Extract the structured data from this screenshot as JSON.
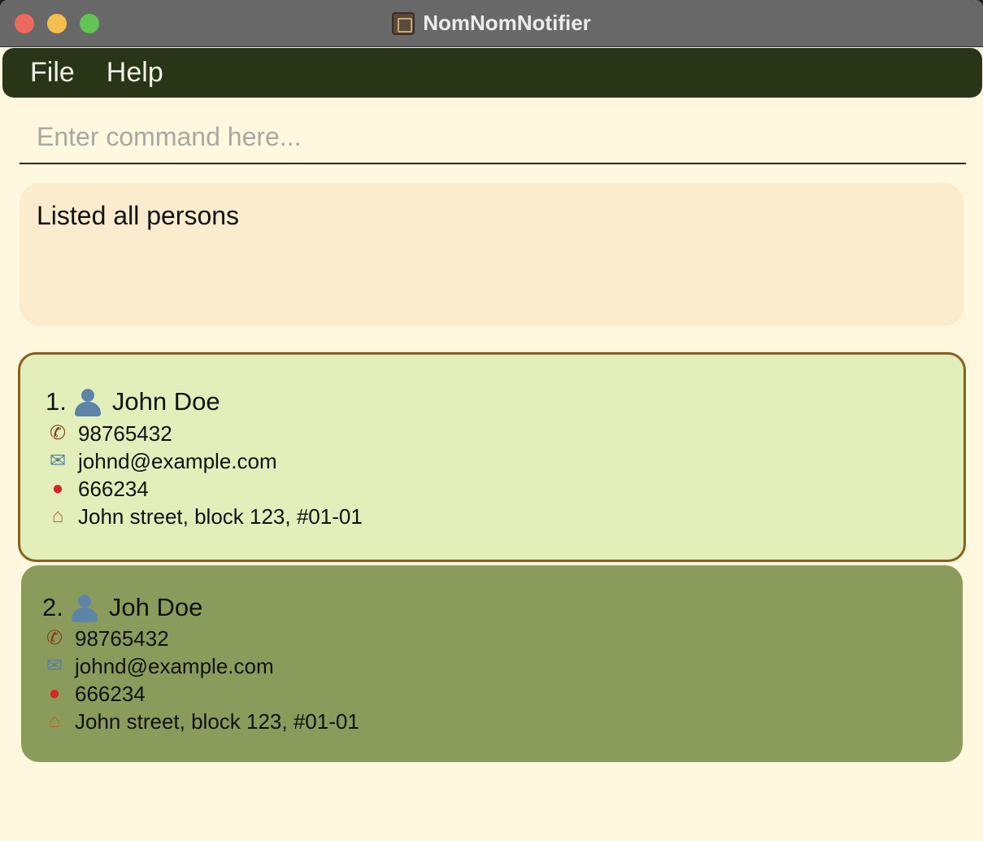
{
  "window": {
    "title": "NomNomNotifier"
  },
  "menu": {
    "items": [
      "File",
      "Help"
    ]
  },
  "command": {
    "placeholder": "Enter command here..."
  },
  "result": {
    "message": "Listed all persons"
  },
  "persons": [
    {
      "index": "1.",
      "name": "John Doe",
      "phone": "98765432",
      "email": "johnd@example.com",
      "postal": "666234",
      "address": "John street, block 123, #01-01",
      "selected": true
    },
    {
      "index": "2.",
      "name": "Joh Doe",
      "phone": "98765432",
      "email": "johnd@example.com",
      "postal": "666234",
      "address": "John street, block 123, #01-01",
      "selected": false
    }
  ],
  "icons": {
    "person": "person-icon",
    "phone": "phone-icon",
    "email": "email-icon",
    "postal": "pin-icon",
    "address": "house-icon"
  },
  "colors": {
    "background": "#fff8df",
    "menubar": "#283516",
    "result_box": "#faeccd",
    "selected_card": "#e2efba",
    "selected_border": "#8a5f21",
    "card": "#8a9c5b"
  }
}
